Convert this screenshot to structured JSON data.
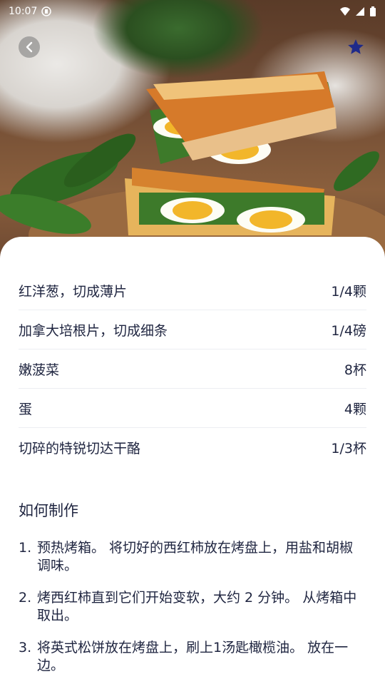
{
  "status": {
    "time": "10:07"
  },
  "hero": {
    "image": "grilled-cheese-spinach-egg-sandwich"
  },
  "ingredients": [
    {
      "name": "红洋葱，切成薄片",
      "amount": "1/4颗"
    },
    {
      "name": "加拿大培根片，切成细条",
      "amount": "1/4磅"
    },
    {
      "name": "嫩菠菜",
      "amount": "8杯"
    },
    {
      "name": "蛋",
      "amount": "4颗"
    },
    {
      "name": "切碎的特锐切达干酪",
      "amount": "1/3杯"
    }
  ],
  "method": {
    "title": "如何制作",
    "steps": [
      {
        "num": "1.",
        "text": "预热烤箱。 将切好的西红柿放在烤盘上，用盐和胡椒调味。"
      },
      {
        "num": "2.",
        "text": "烤西红柿直到它们开始变软，大约 2 分钟。 从烤箱中取出。"
      },
      {
        "num": "3.",
        "text": "将英式松饼放在烤盘上，刷上1汤匙橄榄油。 放在一边。"
      }
    ]
  },
  "colors": {
    "text": "#1f2540",
    "divider": "#eceef2",
    "favorite": "#1f2a8a"
  }
}
